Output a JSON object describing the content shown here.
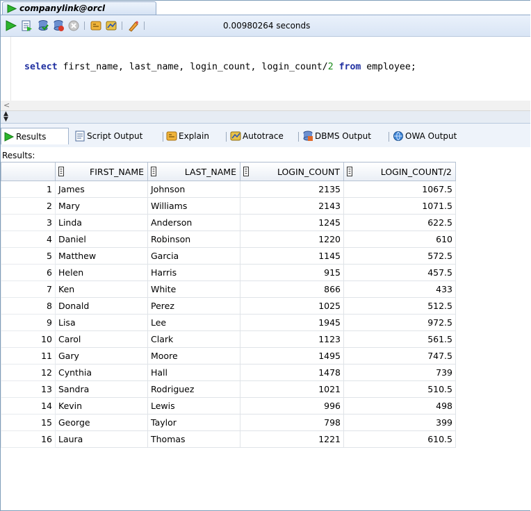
{
  "document_tab": {
    "label": "companylink@orcl"
  },
  "toolbar": {
    "timing": "0.00980264 seconds",
    "icons": [
      "run-statement-icon",
      "run-script-icon",
      "commit-icon",
      "rollback-icon",
      "cancel-icon",
      "explain-plan-icon",
      "autotrace-icon",
      "clear-icon"
    ]
  },
  "editor": {
    "sql_kw_select": "select",
    "sql_cols": " first_name, last_name, login_count, login_count/",
    "sql_num": "2",
    "sql_kw_from": "from",
    "sql_table": " employee;"
  },
  "result_tabs": [
    {
      "label": "Results",
      "icon": "run-icon"
    },
    {
      "label": "Script Output",
      "icon": "script-icon"
    },
    {
      "label": "Explain",
      "icon": "explain-icon"
    },
    {
      "label": "Autotrace",
      "icon": "autotrace-icon"
    },
    {
      "label": "DBMS Output",
      "icon": "dbms-icon"
    },
    {
      "label": "OWA Output",
      "icon": "owa-icon"
    }
  ],
  "results_label": "Results:",
  "grid": {
    "columns": [
      "FIRST_NAME",
      "LAST_NAME",
      "LOGIN_COUNT",
      "LOGIN_COUNT/2"
    ],
    "rows": [
      [
        "1",
        "James",
        "Johnson",
        "2135",
        "1067.5"
      ],
      [
        "2",
        "Mary",
        "Williams",
        "2143",
        "1071.5"
      ],
      [
        "3",
        "Linda",
        "Anderson",
        "1245",
        "622.5"
      ],
      [
        "4",
        "Daniel",
        "Robinson",
        "1220",
        "610"
      ],
      [
        "5",
        "Matthew",
        "Garcia",
        "1145",
        "572.5"
      ],
      [
        "6",
        "Helen",
        "Harris",
        "915",
        "457.5"
      ],
      [
        "7",
        "Ken",
        "White",
        "866",
        "433"
      ],
      [
        "8",
        "Donald",
        "Perez",
        "1025",
        "512.5"
      ],
      [
        "9",
        "Lisa",
        "Lee",
        "1945",
        "972.5"
      ],
      [
        "10",
        "Carol",
        "Clark",
        "1123",
        "561.5"
      ],
      [
        "11",
        "Gary",
        "Moore",
        "1495",
        "747.5"
      ],
      [
        "12",
        "Cynthia",
        "Hall",
        "1478",
        "739"
      ],
      [
        "13",
        "Sandra",
        "Rodriguez",
        "1021",
        "510.5"
      ],
      [
        "14",
        "Kevin",
        "Lewis",
        "996",
        "498"
      ],
      [
        "15",
        "George",
        "Taylor",
        "798",
        "399"
      ],
      [
        "16",
        "Laura",
        "Thomas",
        "1221",
        "610.5"
      ]
    ]
  }
}
